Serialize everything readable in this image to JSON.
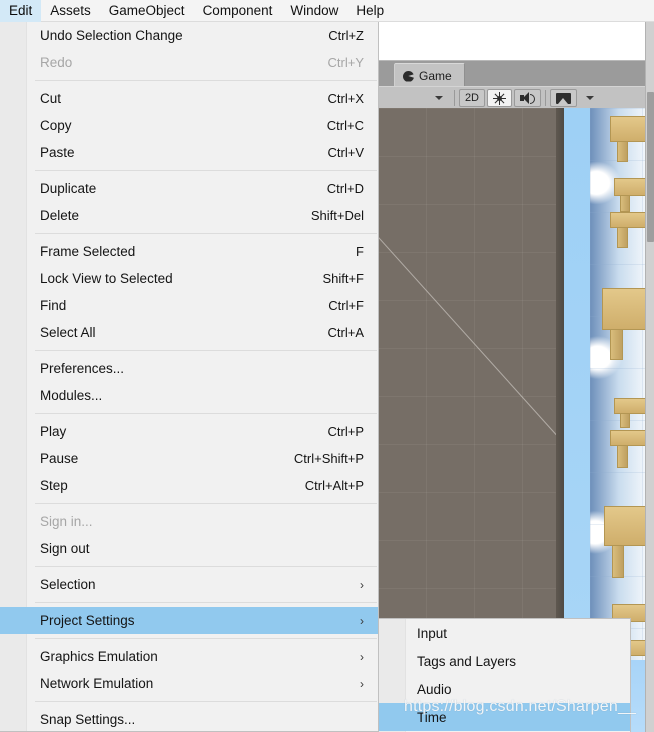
{
  "app": {
    "name": "Unity Editor",
    "accent_highlight": "#91c9ee",
    "menubar_active_bg": "#d3e9f7"
  },
  "menubar": {
    "items": [
      {
        "label": "Edit",
        "active": true
      },
      {
        "label": "Assets",
        "active": false
      },
      {
        "label": "GameObject",
        "active": false
      },
      {
        "label": "Component",
        "active": false
      },
      {
        "label": "Window",
        "active": false
      },
      {
        "label": "Help",
        "active": false
      }
    ]
  },
  "edit_menu": {
    "groups": [
      {
        "items": [
          {
            "label": "Undo Selection Change",
            "accel": "Ctrl+Z",
            "disabled": false,
            "submenu": false,
            "highlight": false
          },
          {
            "label": "Redo",
            "accel": "Ctrl+Y",
            "disabled": true,
            "submenu": false,
            "highlight": false
          }
        ]
      },
      {
        "items": [
          {
            "label": "Cut",
            "accel": "Ctrl+X",
            "disabled": false,
            "submenu": false,
            "highlight": false
          },
          {
            "label": "Copy",
            "accel": "Ctrl+C",
            "disabled": false,
            "submenu": false,
            "highlight": false
          },
          {
            "label": "Paste",
            "accel": "Ctrl+V",
            "disabled": false,
            "submenu": false,
            "highlight": false
          }
        ]
      },
      {
        "items": [
          {
            "label": "Duplicate",
            "accel": "Ctrl+D",
            "disabled": false,
            "submenu": false,
            "highlight": false
          },
          {
            "label": "Delete",
            "accel": "Shift+Del",
            "disabled": false,
            "submenu": false,
            "highlight": false
          }
        ]
      },
      {
        "items": [
          {
            "label": "Frame Selected",
            "accel": "F",
            "disabled": false,
            "submenu": false,
            "highlight": false
          },
          {
            "label": "Lock View to Selected",
            "accel": "Shift+F",
            "disabled": false,
            "submenu": false,
            "highlight": false
          },
          {
            "label": "Find",
            "accel": "Ctrl+F",
            "disabled": false,
            "submenu": false,
            "highlight": false
          },
          {
            "label": "Select All",
            "accel": "Ctrl+A",
            "disabled": false,
            "submenu": false,
            "highlight": false
          }
        ]
      },
      {
        "items": [
          {
            "label": "Preferences...",
            "accel": "",
            "disabled": false,
            "submenu": false,
            "highlight": false
          },
          {
            "label": "Modules...",
            "accel": "",
            "disabled": false,
            "submenu": false,
            "highlight": false
          }
        ]
      },
      {
        "items": [
          {
            "label": "Play",
            "accel": "Ctrl+P",
            "disabled": false,
            "submenu": false,
            "highlight": false
          },
          {
            "label": "Pause",
            "accel": "Ctrl+Shift+P",
            "disabled": false,
            "submenu": false,
            "highlight": false
          },
          {
            "label": "Step",
            "accel": "Ctrl+Alt+P",
            "disabled": false,
            "submenu": false,
            "highlight": false
          }
        ]
      },
      {
        "items": [
          {
            "label": "Sign in...",
            "accel": "",
            "disabled": true,
            "submenu": false,
            "highlight": false
          },
          {
            "label": "Sign out",
            "accel": "",
            "disabled": false,
            "submenu": false,
            "highlight": false
          }
        ]
      },
      {
        "items": [
          {
            "label": "Selection",
            "accel": "",
            "disabled": false,
            "submenu": true,
            "highlight": false
          }
        ]
      },
      {
        "items": [
          {
            "label": "Project Settings",
            "accel": "",
            "disabled": false,
            "submenu": true,
            "highlight": true
          }
        ]
      },
      {
        "items": [
          {
            "label": "Graphics Emulation",
            "accel": "",
            "disabled": false,
            "submenu": true,
            "highlight": false
          },
          {
            "label": "Network Emulation",
            "accel": "",
            "disabled": false,
            "submenu": true,
            "highlight": false
          }
        ]
      },
      {
        "items": [
          {
            "label": "Snap Settings...",
            "accel": "",
            "disabled": false,
            "submenu": false,
            "highlight": false
          }
        ]
      }
    ]
  },
  "project_settings_submenu": {
    "title": "Project Settings",
    "items": [
      {
        "label": "Input",
        "highlight": false
      },
      {
        "label": "Tags and Layers",
        "highlight": false
      },
      {
        "label": "Audio",
        "highlight": false
      },
      {
        "label": "Time",
        "highlight": true
      }
    ]
  },
  "game_panel": {
    "tab_label": "Game",
    "tab_icon": "game-view-icon",
    "toolbar": {
      "aspect_dropdown_icon": "chevron-down-icon",
      "mode_label": "2D",
      "lighting_icon": "sun-icon",
      "audio_icon": "speaker-icon",
      "gizmos_icon": "image-icon",
      "gizmos_dropdown_icon": "chevron-down-icon"
    },
    "scene": {
      "gizmo": "y-axis-translate-gizmo",
      "objects": "wooden-table-props"
    }
  },
  "watermark": {
    "text": "https://blog.csdn.net/Sharpen__"
  },
  "scrollbar": {
    "name": "vertical-scrollbar"
  }
}
